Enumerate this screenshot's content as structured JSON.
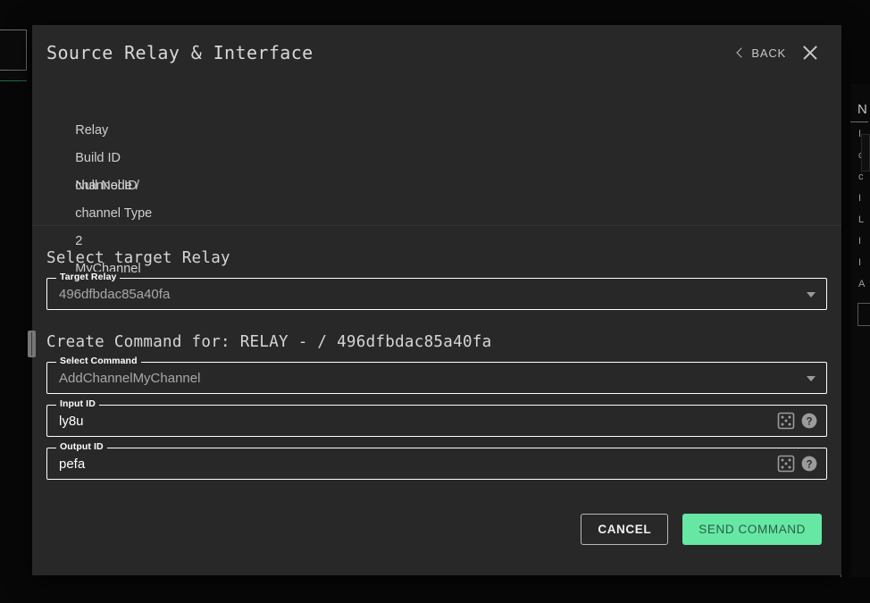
{
  "background": {
    "right_panel": {
      "title": "N",
      "items": [
        "I",
        "c",
        "c",
        "I",
        "L",
        "I",
        "I",
        "A"
      ]
    }
  },
  "modal": {
    "title": "Source Relay & Interface",
    "back_label": "BACK",
    "back_icon": "chevron-left-icon",
    "close_icon": "close-icon",
    "info_rows": [
      {
        "key": "Relay",
        "value": "Null Node /"
      },
      {
        "key": "Build ID",
        "value": ""
      },
      {
        "key": "channel ID",
        "value": "2"
      },
      {
        "key": "channel Type",
        "value": "MyChannel"
      }
    ],
    "target_section": {
      "heading": "Select target Relay",
      "select": {
        "label": "Target Relay",
        "value": "496dfbdac85a40fa",
        "caret_icon": "chevron-down-icon"
      }
    },
    "command_section": {
      "heading": "Create Command for: RELAY - / 496dfbdac85a40fa",
      "command_select": {
        "label": "Select Command",
        "value": "AddChannelMyChannel",
        "caret_icon": "chevron-down-icon"
      },
      "input_id": {
        "label": "Input ID",
        "value": "ly8u",
        "dice_icon": "dice-icon",
        "help_icon": "help-circle-icon"
      },
      "output_id": {
        "label": "Output ID",
        "value": "pefa",
        "dice_icon": "dice-icon",
        "help_icon": "help-circle-icon"
      }
    },
    "footer": {
      "cancel_label": "CANCEL",
      "send_label": "SEND COMMAND"
    }
  },
  "colors": {
    "modal_bg": "#282828",
    "page_bg": "#070707",
    "accent_green": "#66e8a4",
    "outline": "#ffffff",
    "divider": "#333333"
  }
}
